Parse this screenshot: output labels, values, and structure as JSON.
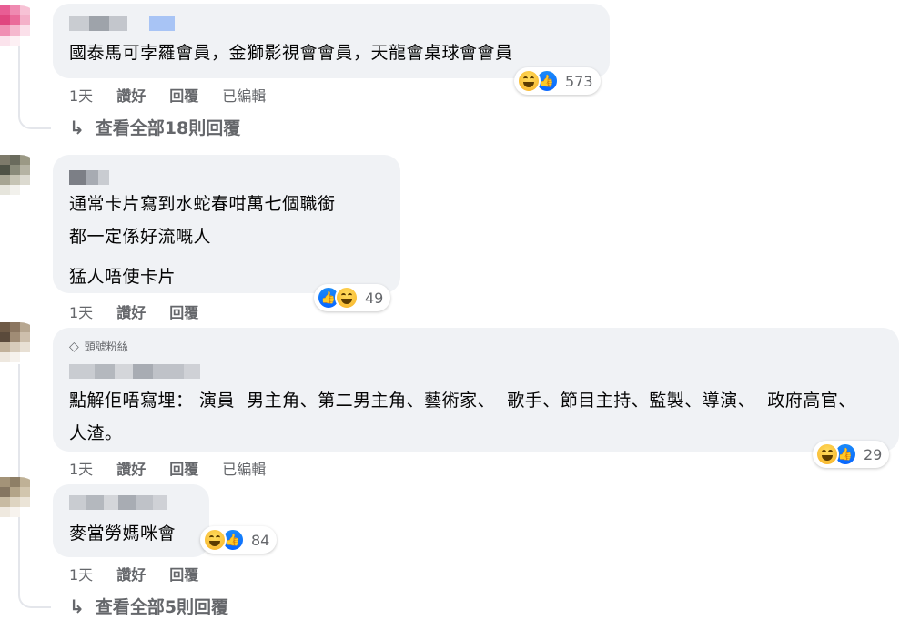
{
  "comments": [
    {
      "text": "國泰馬可孛羅會員，金獅影視會會員，天龍會桌球會會員",
      "time": "1天",
      "like_label": "讚好",
      "reply_label": "回覆",
      "edited_label": "已編輯",
      "reaction_count": "573",
      "reactions": [
        "haha-icon",
        "like-icon"
      ]
    },
    {
      "lines": [
        "通常卡片寫到水蛇春咁萬七個職銜",
        "都一定係好流嘅人",
        "猛人唔使卡片"
      ],
      "time": "1天",
      "like_label": "讚好",
      "reply_label": "回覆",
      "reaction_count": "49",
      "reactions": [
        "like-icon",
        "haha-icon"
      ]
    },
    {
      "badge": "頭號粉絲",
      "text": "點解佢唔寫埋： 演員  男主角、第二男主角、藝術家、  歌手、節目主持、監製、導演、  政府高官、人渣。",
      "time": "1天",
      "like_label": "讚好",
      "reply_label": "回覆",
      "edited_label": "已編輯",
      "reaction_count": "29",
      "reactions": [
        "haha-icon",
        "like-icon"
      ]
    },
    {
      "text": "麥當勞媽咪會",
      "time": "1天",
      "like_label": "讚好",
      "reply_label": "回覆",
      "reaction_count": "84",
      "reactions": [
        "haha-icon",
        "like-icon"
      ]
    }
  ],
  "view_replies": [
    "查看全部18則回覆",
    "查看全部5則回覆"
  ],
  "colors": {
    "bubble": "#f0f2f5",
    "meta": "#65676b",
    "like": "#0866ff",
    "haha": "#f7b125"
  }
}
